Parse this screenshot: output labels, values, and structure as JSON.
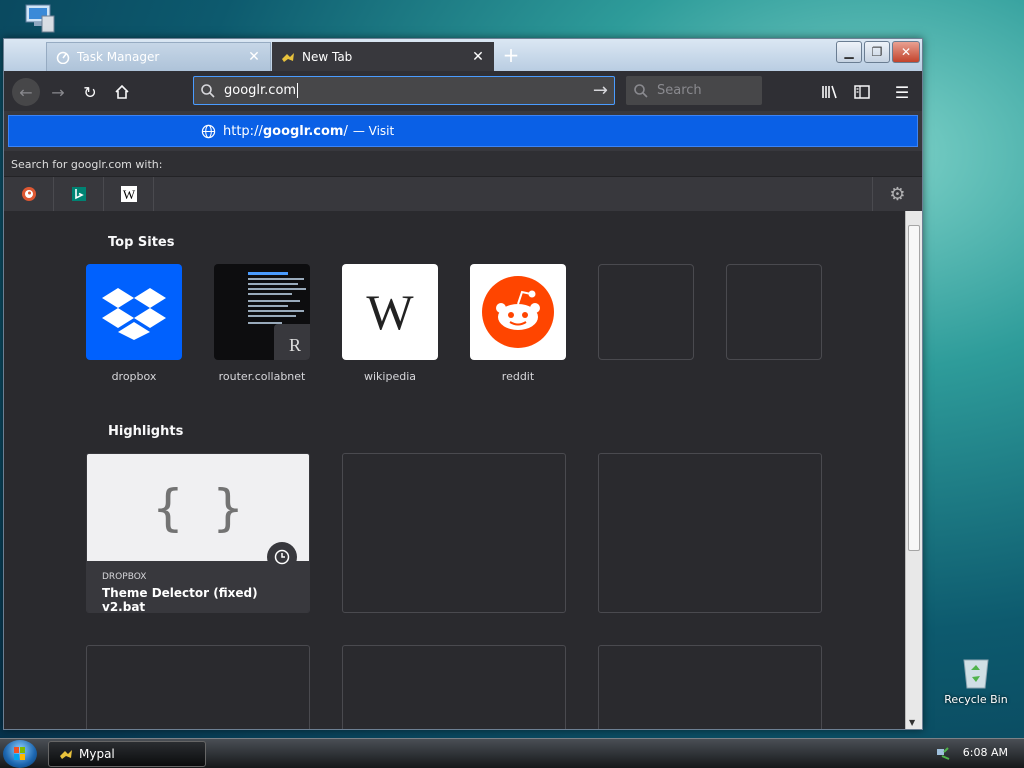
{
  "desktop": {
    "recycle_bin_label": "Recycle Bin"
  },
  "browser": {
    "tabs": [
      {
        "label": "Task Manager",
        "active": false
      },
      {
        "label": "New Tab",
        "active": true
      }
    ],
    "url_value": "googlr.com",
    "search_placeholder": "Search",
    "suggestion": {
      "prefix": "http://",
      "domain": "googlr.com",
      "suffix": "/",
      "action": "— Visit"
    },
    "search_with_label": "Search for googlr.com with:",
    "top_sites_title": "Top Sites",
    "top_sites": [
      {
        "label": "dropbox",
        "icon": "dropbox-icon"
      },
      {
        "label": "router.collabnet",
        "icon": "screenshot-thumbnail",
        "badge": "R"
      },
      {
        "label": "wikipedia",
        "icon": "wikipedia-icon",
        "letter": "W"
      },
      {
        "label": "reddit",
        "icon": "reddit-icon"
      }
    ],
    "highlights_title": "Highlights",
    "highlight": {
      "source": "DROPBOX",
      "title": "Theme Delector (fixed) v2.bat",
      "glyph": "{ }"
    }
  },
  "taskbar": {
    "task_label": "Mypal",
    "clock": "6:08 AM"
  },
  "colors": {
    "accent": "#0a60e6",
    "dropbox": "#0061fe",
    "reddit": "#ff4500",
    "close": "#c2432c"
  }
}
